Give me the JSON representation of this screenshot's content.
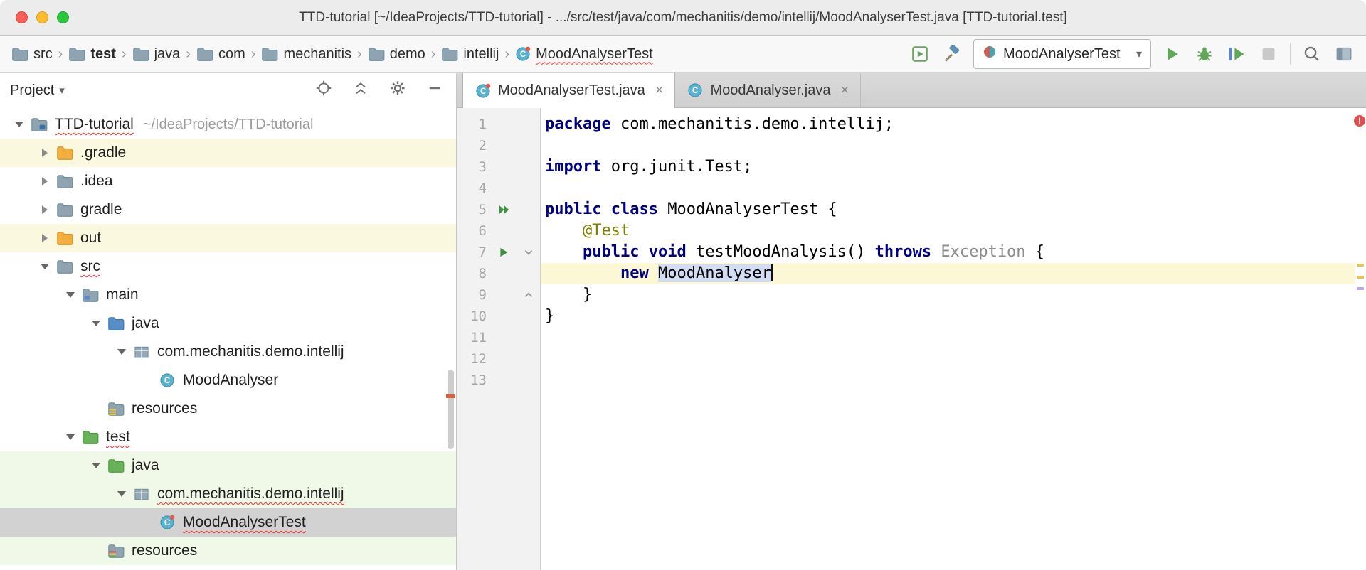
{
  "window": {
    "title": "TTD-tutorial [~/IdeaProjects/TTD-tutorial] - .../src/test/java/com/mechanitis/demo/intellij/MoodAnalyserTest.java [TTD-tutorial.test]"
  },
  "icons": {
    "close_tab": "×",
    "chevron_down": "▾",
    "breadcrumb_separator": "›"
  },
  "colors": {
    "keyword": "#000080",
    "annotation": "#808000",
    "muted_symbol": "#8c8c8c",
    "error_underline": "#ff2f2f",
    "current_line": "#fcf7d4",
    "identifier_highlight": "#d2ddf4",
    "row_selected": "#d2d2d2",
    "row_green": "#f0f8e8",
    "row_yellow": "#fbf8e0",
    "run_green": "#5fa855"
  },
  "breadcrumbs": {
    "items": [
      {
        "label": "src",
        "icon": "folder"
      },
      {
        "label": "test",
        "icon": "folder",
        "bold": true
      },
      {
        "label": "java",
        "icon": "folder"
      },
      {
        "label": "com",
        "icon": "folder"
      },
      {
        "label": "mechanitis",
        "icon": "folder"
      },
      {
        "label": "demo",
        "icon": "folder"
      },
      {
        "label": "intellij",
        "icon": "folder"
      },
      {
        "label": "MoodAnalyserTest",
        "icon": "test-class",
        "error": true
      }
    ]
  },
  "run": {
    "config_label": "MoodAnalyserTest"
  },
  "project_panel": {
    "title": "Project",
    "tree": [
      {
        "level": 0,
        "twisty": "open",
        "icon": "project-folder",
        "label": "TTD-tutorial",
        "hint": "~/IdeaProjects/TTD-tutorial",
        "error": true,
        "bg": "none"
      },
      {
        "level": 1,
        "twisty": "closed",
        "icon": "folder-excluded",
        "label": ".gradle",
        "bg": "yellow"
      },
      {
        "level": 1,
        "twisty": "closed",
        "icon": "folder",
        "label": ".idea",
        "bg": "none"
      },
      {
        "level": 1,
        "twisty": "closed",
        "icon": "folder",
        "label": "gradle",
        "bg": "none"
      },
      {
        "level": 1,
        "twisty": "closed",
        "icon": "folder-excluded",
        "label": "out",
        "bg": "yellow"
      },
      {
        "level": 1,
        "twisty": "open",
        "icon": "folder",
        "label": "src",
        "error": true,
        "bg": "none"
      },
      {
        "level": 2,
        "twisty": "open",
        "icon": "module-folder",
        "label": "main",
        "bg": "none"
      },
      {
        "level": 3,
        "twisty": "open",
        "icon": "source-root-folder",
        "label": "java",
        "bg": "none"
      },
      {
        "level": 4,
        "twisty": "open",
        "icon": "package",
        "label": "com.mechanitis.demo.intellij",
        "bg": "none"
      },
      {
        "level": 5,
        "twisty": "none",
        "icon": "class",
        "label": "MoodAnalyser",
        "bg": "none"
      },
      {
        "level": 3,
        "twisty": "none",
        "icon": "resources-folder",
        "label": "resources",
        "bg": "none"
      },
      {
        "level": 2,
        "twisty": "open",
        "icon": "test-folder",
        "label": "test",
        "error": true,
        "bg": "none"
      },
      {
        "level": 3,
        "twisty": "open",
        "icon": "test-source-folder",
        "label": "java",
        "bg": "green"
      },
      {
        "level": 4,
        "twisty": "open",
        "icon": "package",
        "label": "com.mechanitis.demo.intellij",
        "error": true,
        "bg": "green"
      },
      {
        "level": 5,
        "twisty": "none",
        "icon": "test-class",
        "label": "MoodAnalyserTest",
        "error": true,
        "selected": true,
        "bg": "none"
      },
      {
        "level": 3,
        "twisty": "none",
        "icon": "test-resources-folder",
        "label": "resources",
        "bg": "green"
      }
    ]
  },
  "editor": {
    "tabs": [
      {
        "label": "MoodAnalyserTest.java",
        "icon": "test-class",
        "active": true
      },
      {
        "label": "MoodAnalyser.java",
        "icon": "class",
        "active": false
      }
    ],
    "line_count": 13,
    "caret_line": 8,
    "gutter_icons": {
      "5": "run-all",
      "7": "run"
    },
    "folds": {
      "7": "open",
      "9": "close"
    },
    "lines": [
      {
        "n": 1,
        "tokens": [
          [
            "package",
            "kw"
          ],
          [
            " com.mechanitis.demo.intellij;",
            "plain"
          ]
        ]
      },
      {
        "n": 2,
        "tokens": []
      },
      {
        "n": 3,
        "tokens": [
          [
            "import",
            "kw"
          ],
          [
            " org.junit.Test;",
            "plain"
          ]
        ]
      },
      {
        "n": 4,
        "tokens": []
      },
      {
        "n": 5,
        "tokens": [
          [
            "public",
            "kw"
          ],
          [
            " ",
            "plain"
          ],
          [
            "class",
            "kw"
          ],
          [
            " MoodAnalyserTest {",
            "plain"
          ]
        ]
      },
      {
        "n": 6,
        "tokens": [
          [
            "    @Test",
            "ann"
          ]
        ]
      },
      {
        "n": 7,
        "tokens": [
          [
            "    ",
            "plain"
          ],
          [
            "public",
            "kw"
          ],
          [
            " ",
            "plain"
          ],
          [
            "void",
            "kw"
          ],
          [
            " testMoodAnalysis() ",
            "plain"
          ],
          [
            "throws",
            "kw"
          ],
          [
            " ",
            "plain"
          ],
          [
            "Exception",
            "muted"
          ],
          [
            " {",
            "plain"
          ]
        ]
      },
      {
        "n": 8,
        "tokens": [
          [
            "        ",
            "plain"
          ],
          [
            "new",
            "kw"
          ],
          [
            " ",
            "plain"
          ],
          [
            "MoodAnalyser",
            "ref"
          ]
        ]
      },
      {
        "n": 9,
        "tokens": [
          [
            "    }",
            "plain"
          ]
        ]
      },
      {
        "n": 10,
        "tokens": [
          [
            "}",
            "plain"
          ]
        ]
      },
      {
        "n": 11,
        "tokens": []
      },
      {
        "n": 12,
        "tokens": []
      },
      {
        "n": 13,
        "tokens": []
      }
    ]
  }
}
